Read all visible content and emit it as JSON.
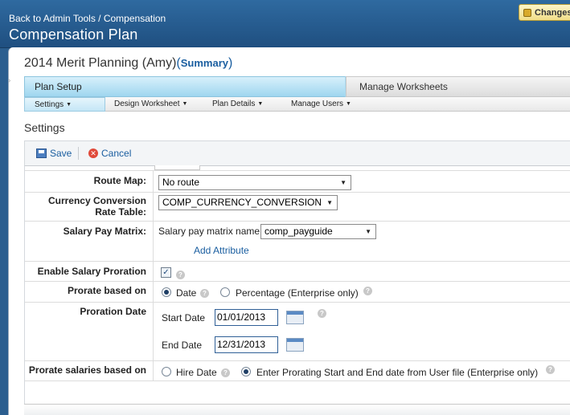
{
  "header": {
    "breadcrumb": "Back to Admin Tools / Compensation",
    "title": "Compensation Plan",
    "changes_label": "Changes"
  },
  "plan": {
    "title": "2014 Merit Planning (Amy)",
    "summary_open": "(",
    "summary_label": "Summary",
    "summary_close": ")"
  },
  "steps": {
    "active": "Plan Setup",
    "next": "Manage Worksheets"
  },
  "subnav": [
    {
      "label": "Settings"
    },
    {
      "label": "Design Worksheet"
    },
    {
      "label": "Plan Details"
    },
    {
      "label": "Manage Users"
    }
  ],
  "section_title": "Settings",
  "toolbar": {
    "save_label": "Save",
    "cancel_label": "Cancel"
  },
  "form": {
    "route_map": {
      "label": "Route Map:",
      "value": "No route"
    },
    "currency": {
      "label_line1": "Currency Conversion",
      "label_line2": "Rate Table:",
      "value": "COMP_CURRENCY_CONVERSION"
    },
    "pay_matrix": {
      "label": "Salary Pay Matrix:",
      "prefix": "Salary pay matrix name",
      "value": "comp_payguide",
      "add_attribute": "Add Attribute"
    },
    "proration": {
      "label": "Enable Salary Proration",
      "checked": true
    },
    "prorate_basis": {
      "label": "Prorate based on",
      "options": [
        "Date",
        "Percentage (Enterprise only)"
      ],
      "selected": "Date"
    },
    "proration_date": {
      "label": "Proration Date",
      "start_label": "Start Date",
      "start_value": "01/01/2013",
      "end_label": "End Date",
      "end_value": "12/31/2013"
    },
    "prorate_salaries": {
      "label": "Prorate salaries based on",
      "options": [
        "Hire Date",
        "Enter Prorating Start and End date from User file (Enterprise only)"
      ],
      "selected": "Enter Prorating Start and End date from User file (Enterprise only)"
    }
  },
  "colors": {
    "header_bg": "#2b5e8f",
    "link": "#1a5ea0",
    "active_step": "#9fd6ef"
  }
}
